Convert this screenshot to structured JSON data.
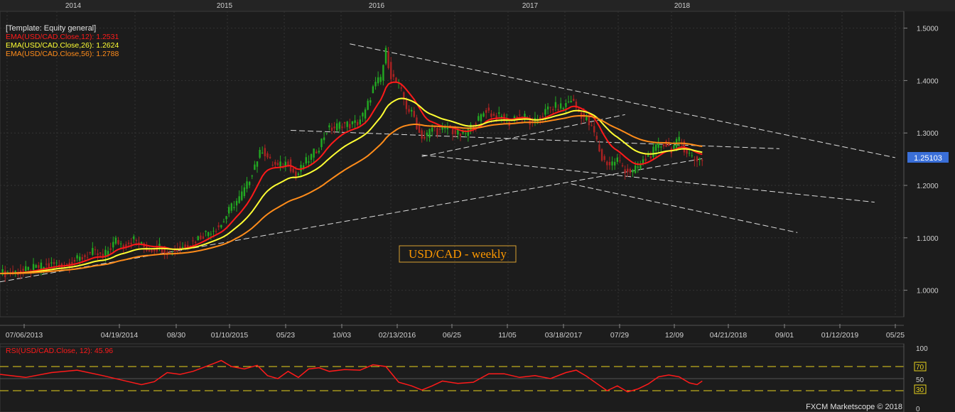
{
  "chart_data": [
    {
      "type": "candlestick",
      "title": "USD/CAD - weekly",
      "template_label": "[Template: Equity general]",
      "top_axis_labels": [
        "2014",
        "2015",
        "2016",
        "2017",
        "2018"
      ],
      "x_tick_labels": [
        "07/06/2013",
        "04/19/2014",
        "08/30",
        "01/10/2015",
        "05/23",
        "10/03",
        "02/13/2016",
        "06/25",
        "11/05",
        "03/18/2017",
        "07/29",
        "12/09",
        "04/21/2018",
        "09/01",
        "01/12/2019",
        "05/25"
      ],
      "y_tick_labels": [
        "1.0000",
        "1.1000",
        "1.2000",
        "1.3000",
        "1.4000",
        "1.5000"
      ],
      "ylim": [
        0.95,
        1.51
      ],
      "last_price_label": "1.25103",
      "grid": true,
      "legend": [
        {
          "name": "EMA(USD/CAD.Close,12)",
          "value": "1.2531",
          "color": "#ff1a1a"
        },
        {
          "name": "EMA(USD/CAD.Close,26)",
          "value": "1.2624",
          "color": "#ffff33"
        },
        {
          "name": "EMA(USD/CAD.Close,56)",
          "value": "1.2788",
          "color": "#ff8c1a"
        }
      ],
      "close_path": [
        [
          0,
          1.032
        ],
        [
          9,
          1.036
        ],
        [
          16,
          1.045
        ],
        [
          22,
          1.05
        ],
        [
          25,
          1.048
        ],
        [
          31,
          1.06
        ],
        [
          36,
          1.072
        ],
        [
          40,
          1.063
        ],
        [
          45,
          1.095
        ],
        [
          48,
          1.086
        ],
        [
          52,
          1.097
        ],
        [
          55,
          1.085
        ],
        [
          58,
          1.078
        ],
        [
          62,
          1.083
        ],
        [
          66,
          1.072
        ],
        [
          70,
          1.08
        ],
        [
          74,
          1.09
        ],
        [
          78,
          1.103
        ],
        [
          82,
          1.115
        ],
        [
          86,
          1.125
        ],
        [
          90,
          1.16
        ],
        [
          93,
          1.175
        ],
        [
          96,
          1.2
        ],
        [
          99,
          1.24
        ],
        [
          102,
          1.27
        ],
        [
          105,
          1.245
        ],
        [
          108,
          1.235
        ],
        [
          112,
          1.245
        ],
        [
          115,
          1.215
        ],
        [
          118,
          1.24
        ],
        [
          121,
          1.255
        ],
        [
          124,
          1.275
        ],
        [
          127,
          1.305
        ],
        [
          130,
          1.31
        ],
        [
          133,
          1.318
        ],
        [
          136,
          1.315
        ],
        [
          139,
          1.32
        ],
        [
          142,
          1.34
        ],
        [
          145,
          1.385
        ],
        [
          148,
          1.405
        ],
        [
          150,
          1.455
        ],
        [
          152,
          1.41
        ],
        [
          155,
          1.39
        ],
        [
          158,
          1.35
        ],
        [
          161,
          1.33
        ],
        [
          163,
          1.3
        ],
        [
          165,
          1.29
        ],
        [
          168,
          1.31
        ],
        [
          171,
          1.302
        ],
        [
          174,
          1.31
        ],
        [
          177,
          1.3
        ],
        [
          180,
          1.295
        ],
        [
          183,
          1.31
        ],
        [
          186,
          1.325
        ],
        [
          189,
          1.345
        ],
        [
          192,
          1.332
        ],
        [
          195,
          1.33
        ],
        [
          198,
          1.32
        ],
        [
          201,
          1.335
        ],
        [
          204,
          1.33
        ],
        [
          207,
          1.315
        ],
        [
          210,
          1.33
        ],
        [
          213,
          1.345
        ],
        [
          216,
          1.35
        ],
        [
          219,
          1.35
        ],
        [
          222,
          1.365
        ],
        [
          225,
          1.34
        ],
        [
          228,
          1.325
        ],
        [
          231,
          1.3
        ],
        [
          234,
          1.25
        ],
        [
          237,
          1.24
        ],
        [
          240,
          1.25
        ],
        [
          243,
          1.23
        ],
        [
          246,
          1.225
        ],
        [
          249,
          1.24
        ],
        [
          252,
          1.255
        ],
        [
          255,
          1.27
        ],
        [
          258,
          1.28
        ],
        [
          261,
          1.27
        ],
        [
          264,
          1.285
        ],
        [
          267,
          1.265
        ],
        [
          270,
          1.25
        ],
        [
          273,
          1.251
        ]
      ],
      "ema": [
        {
          "name": "EMA(USD/CAD.Close,12)",
          "period": 12
        },
        {
          "name": "EMA(USD/CAD.Close,26)",
          "period": 26
        },
        {
          "name": "EMA(USD/CAD.Close,56)",
          "period": 56
        }
      ],
      "trendlines": [
        {
          "from": [
            0,
            1.016
          ],
          "to": [
            273,
            1.251
          ]
        },
        {
          "from": [
            113,
            1.305
          ],
          "to": [
            303,
            1.27
          ]
        },
        {
          "from": [
            164,
            1.255
          ],
          "to": [
            243,
            1.335
          ]
        },
        {
          "from": [
            136,
            1.47
          ],
          "to": [
            348,
            1.253
          ]
        },
        {
          "from": [
            164,
            1.258
          ],
          "to": [
            340,
            1.168
          ]
        },
        {
          "from": [
            222,
            1.203
          ],
          "to": [
            310,
            1.11
          ]
        }
      ],
      "panel_title": "USD/CAD - weekly"
    },
    {
      "type": "line",
      "legend": [
        {
          "name": "RSI(USD/CAD.Close, 12)",
          "value": "45.96",
          "color": "#ff1a1a"
        }
      ],
      "y_tick_labels": [
        "100",
        "70",
        "50",
        "30",
        "0"
      ],
      "ylim": [
        0,
        100
      ],
      "levels": [
        70,
        50,
        30
      ],
      "rsi_path": [
        [
          0,
          57
        ],
        [
          10,
          52
        ],
        [
          20,
          60
        ],
        [
          30,
          64
        ],
        [
          40,
          55
        ],
        [
          50,
          45
        ],
        [
          55,
          40
        ],
        [
          60,
          45
        ],
        [
          65,
          60
        ],
        [
          70,
          57
        ],
        [
          75,
          62
        ],
        [
          83,
          75
        ],
        [
          86,
          80
        ],
        [
          90,
          70
        ],
        [
          95,
          66
        ],
        [
          100,
          72
        ],
        [
          104,
          55
        ],
        [
          108,
          50
        ],
        [
          112,
          62
        ],
        [
          116,
          52
        ],
        [
          120,
          66
        ],
        [
          124,
          68
        ],
        [
          128,
          62
        ],
        [
          134,
          65
        ],
        [
          140,
          64
        ],
        [
          145,
          73
        ],
        [
          150,
          70
        ],
        [
          155,
          44
        ],
        [
          160,
          38
        ],
        [
          164,
          31
        ],
        [
          168,
          38
        ],
        [
          172,
          46
        ],
        [
          178,
          42
        ],
        [
          184,
          44
        ],
        [
          190,
          58
        ],
        [
          196,
          58
        ],
        [
          202,
          52
        ],
        [
          208,
          55
        ],
        [
          214,
          50
        ],
        [
          220,
          60
        ],
        [
          224,
          64
        ],
        [
          228,
          54
        ],
        [
          232,
          42
        ],
        [
          236,
          30
        ],
        [
          240,
          38
        ],
        [
          244,
          28
        ],
        [
          248,
          33
        ],
        [
          252,
          41
        ],
        [
          256,
          53
        ],
        [
          260,
          56
        ],
        [
          264,
          53
        ],
        [
          268,
          43
        ],
        [
          271,
          40
        ],
        [
          273,
          45.96
        ]
      ]
    }
  ],
  "footer_credit": "FXCM Marketscope © 2018"
}
